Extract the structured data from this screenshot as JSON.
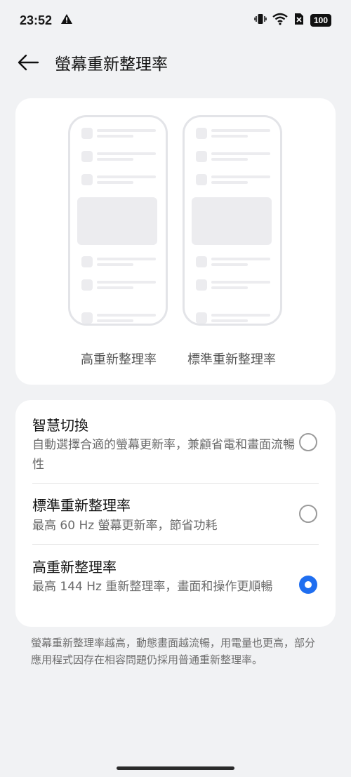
{
  "status": {
    "time": "23:52",
    "battery": "100"
  },
  "header": {
    "title": "螢幕重新整理率"
  },
  "preview": {
    "high_label": "高重新整理率",
    "standard_label": "標準重新整理率"
  },
  "options": [
    {
      "title": "智慧切換",
      "description": "自動選擇合適的螢幕更新率，兼顧省電和畫面流暢性",
      "selected": false
    },
    {
      "title": "標準重新整理率",
      "description": "最高 60 Hz 螢幕更新率，節省功耗",
      "selected": false
    },
    {
      "title": "高重新整理率",
      "description": "最高 144 Hz 重新整理率，畫面和操作更順暢",
      "selected": true
    }
  ],
  "footer_note": "螢幕重新整理率越高，動態畫面越流暢，用電量也更高，部分應用程式因存在相容問題仍採用普通重新整理率。",
  "colors": {
    "accent": "#1f6ef0",
    "background": "#f1f2f4",
    "card": "#ffffff"
  }
}
